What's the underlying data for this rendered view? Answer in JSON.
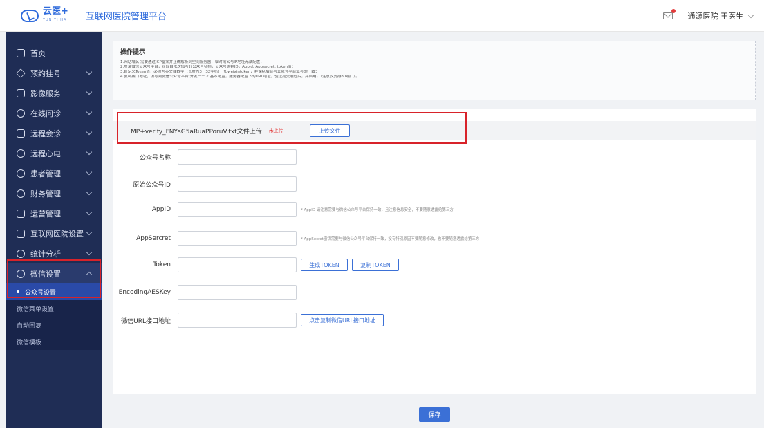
{
  "header": {
    "logo_text": "云医+",
    "logo_sub": "YUN YI JIA",
    "platform_title": "互联网医院管理平台",
    "user": "通源医院 王医生"
  },
  "sidebar": {
    "items": [
      {
        "label": "首页",
        "icon": "home-icon",
        "has_children": false
      },
      {
        "label": "预约挂号",
        "icon": "appointment-icon",
        "has_children": true
      },
      {
        "label": "影像服务",
        "icon": "imaging-icon",
        "has_children": true
      },
      {
        "label": "在线问诊",
        "icon": "consult-icon",
        "has_children": true
      },
      {
        "label": "远程会诊",
        "icon": "remote-consult-icon",
        "has_children": true
      },
      {
        "label": "远程心电",
        "icon": "heart-icon",
        "has_children": true
      },
      {
        "label": "患者管理",
        "icon": "patient-icon",
        "has_children": true
      },
      {
        "label": "财务管理",
        "icon": "finance-icon",
        "has_children": true
      },
      {
        "label": "运营管理",
        "icon": "operation-icon",
        "has_children": true
      },
      {
        "label": "互联网医院设置",
        "icon": "hospital-settings-icon",
        "has_children": true
      },
      {
        "label": "统计分析",
        "icon": "stats-icon",
        "has_children": true
      },
      {
        "label": "微信设置",
        "icon": "wechat-icon",
        "has_children": true
      }
    ],
    "sub_items": [
      "公众号设置",
      "微信菜单设置",
      "自动回复",
      "微信模板"
    ]
  },
  "tips": {
    "title": "操作提示",
    "lines": [
      "1.网站域名 需要通过ICP备案并正确解析到空间服务器，临时域名与IP地址无法配置；",
      "2.登录微信公众号平台，获取目依次填写好公众号名称，公众号原始ID，Appid, Appsecret, token值；",
      "3.自定义Token值，必须为英文或数字（长度为3－32字符），如weixintoken，并保持后台与公众号平台填写的一致；",
      "4.复制接口地址，填写到微信公众号平台 开发－－＞ 基本配置，服务器配置下的URL地址，验证提交通过后，并启用。（注意仅支持80端口）。"
    ]
  },
  "upload": {
    "label": "MP+verify_FNYsG5aRuaPPoruV.txt文件上传",
    "status": "未上传",
    "button": "上传文件"
  },
  "form": {
    "name_label": "公众号名称",
    "origin_id_label": "原始公众号ID",
    "appid_label": "AppID",
    "appid_hint": "* AppID 请注意需要与微信公众号平台保持一致，且注意信息安全，不要随意透露给第三方",
    "appsecret_label": "AppSercret",
    "appsecret_hint": "* AppSecret密钥需要与微信公众号平台保持一致，没有特别原因不要随意修改，也不要随意透露给第三方",
    "token_label": "Token",
    "gen_token": "生成TOKEN",
    "copy_token": "复制TOKEN",
    "aes_label": "EncodingAESKey",
    "url_label": "微信URL接口地址",
    "copy_url": "点击复制微信URL接口地址"
  },
  "save_button": "保存"
}
